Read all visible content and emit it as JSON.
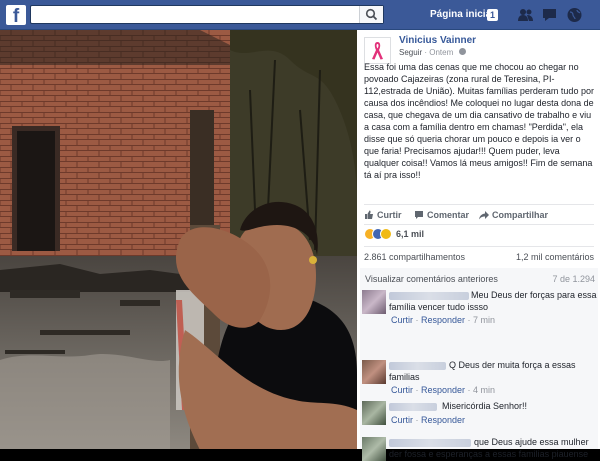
{
  "topbar": {
    "logo": "f",
    "search_placeholder": "",
    "home_label": "Página inicial",
    "notif_count": "1",
    "icons": [
      "friends-icon",
      "messages-icon",
      "globe-icon"
    ],
    "brand_color": "#3b5998"
  },
  "post": {
    "author": "Vinicius Vainner",
    "follow_label": "Seguir",
    "time_label": "Ontem",
    "text": "Essa foi uma das cenas que me chocou ao chegar no povoado Cajazeiras (zona rural de Teresina, PI-112,estrada de União). Muitas famílias perderam tudo por causa dos incêndios! Me coloquei no lugar desta dona de casa, que chegava de um dia cansativo de trabalho e viu a casa com a família dentro em chamas! \"Perdida\", ela disse que só queria chorar um pouco e depois ia ver o que faria! Precisamos ajudar!!! Quem puder, leva qualquer coisa!! Vamos lá meus amigos!! Fim de semana tá aí pra isso!!",
    "actions": {
      "like": "Curtir",
      "comment": "Comentar",
      "share": "Compartilhar"
    },
    "reaction_count": "6,1 mil",
    "shares": "2.861 compartilhamentos",
    "comments_count": "1,2 mil comentários"
  },
  "comments": {
    "view_previous": "Visualizar comentários anteriores",
    "page_count": "7 de 1.294",
    "items": [
      {
        "text": "Meu Deus der forças para essa família vencer tudo issso",
        "reply_like": "Curtir",
        "reply": "Responder",
        "time": "7 min"
      },
      {
        "text": "Q Deus der muita força a essas familias",
        "reply_like": "Curtir",
        "reply": "Responder",
        "time": "4 min"
      },
      {
        "text": "Misericórdia Senhor!!",
        "reply_like": "Curtir",
        "reply": "Responder",
        "time": ""
      },
      {
        "text": "que Deus ajude essa mulher der fossa e esperanças a essas familias piauense",
        "reply_like": "",
        "reply": "",
        "time": ""
      }
    ]
  }
}
